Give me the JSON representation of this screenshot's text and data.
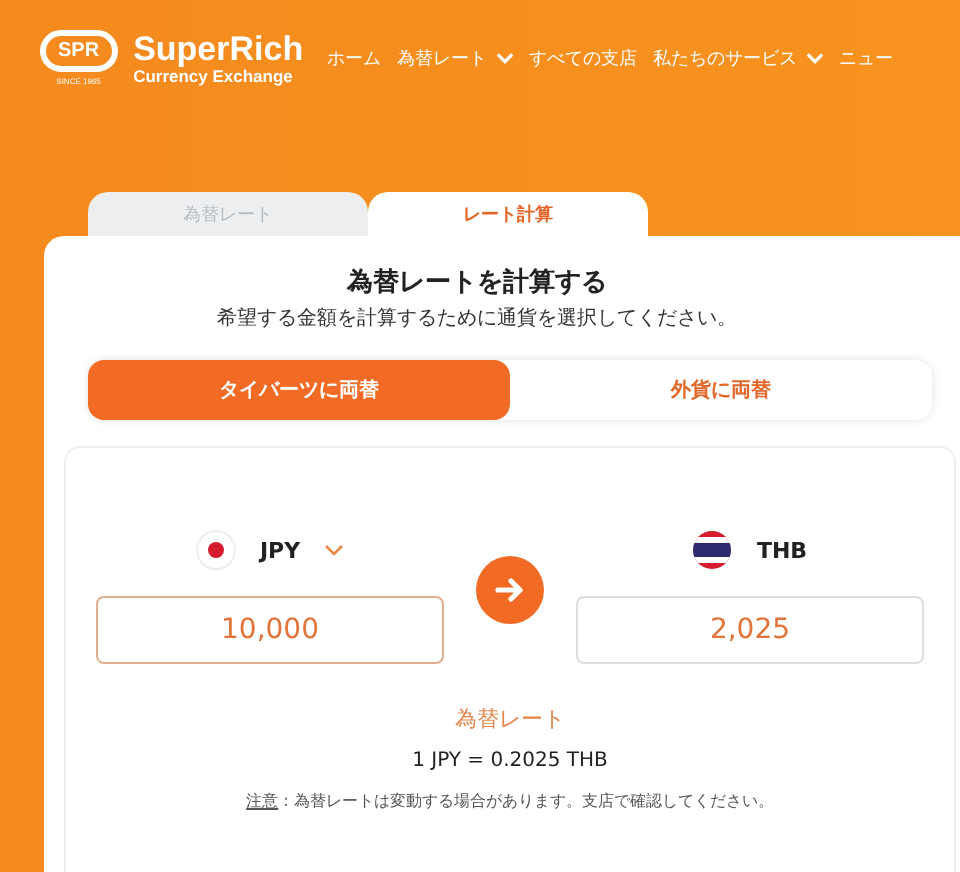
{
  "logo": {
    "badge": "SPR",
    "since": "SINCE 1965",
    "name": "SuperRich",
    "tagline": "Currency Exchange"
  },
  "nav": [
    {
      "label": "ホーム",
      "dropdown": false
    },
    {
      "label": "為替レート",
      "dropdown": true
    },
    {
      "label": "すべての支店",
      "dropdown": false
    },
    {
      "label": "私たちのサービス",
      "dropdown": true
    },
    {
      "label": "ニュー",
      "dropdown": false
    }
  ],
  "tabs": [
    {
      "label": "為替レート",
      "selected": false
    },
    {
      "label": "レート計算",
      "selected": true
    }
  ],
  "title": "為替レートを計算する",
  "subtitle": "希望する金額を計算するために通貨を選択してください。",
  "modes": [
    {
      "label": "タイバーツに両替",
      "selected": true
    },
    {
      "label": "外貨に両替",
      "selected": false
    }
  ],
  "from": {
    "code": "JPY",
    "kind": "jp",
    "dropdown": true,
    "value": "10,000"
  },
  "to": {
    "code": "THB",
    "kind": "th",
    "dropdown": false,
    "value": "2,025"
  },
  "rate_label": "為替レート",
  "rate": "1 JPY = 0.2025 THB",
  "note": {
    "link": "注意",
    "text": " : 為替レートは変動する場合があります。支店で確認してください。"
  }
}
